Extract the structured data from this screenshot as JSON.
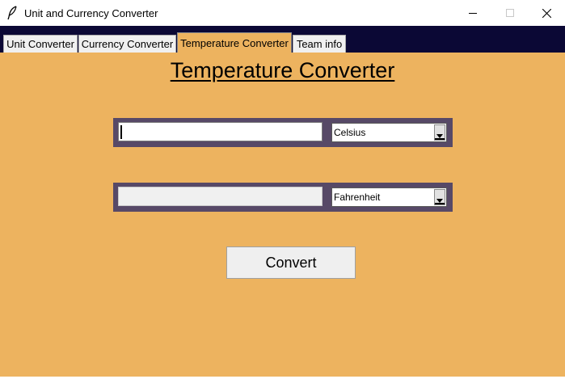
{
  "window": {
    "title": "Unit and Currency Converter",
    "icon": "feather-icon",
    "controls": [
      "minimize-icon",
      "maximize-icon",
      "close-icon"
    ]
  },
  "tabs": [
    {
      "label": "Unit Converter",
      "active": false
    },
    {
      "label": "Currency Converter",
      "active": false
    },
    {
      "label": "Temperature Converter",
      "active": true
    },
    {
      "label": "Team info",
      "active": false
    }
  ],
  "main": {
    "heading": "Temperature Converter",
    "input": {
      "value": "",
      "unit": "Celsius"
    },
    "output": {
      "value": "",
      "unit": "Fahrenheit"
    },
    "convert_label": "Convert"
  },
  "colors": {
    "background": "#edb35f",
    "tab_bar": "#0b0835",
    "field_frame": "#574967"
  }
}
